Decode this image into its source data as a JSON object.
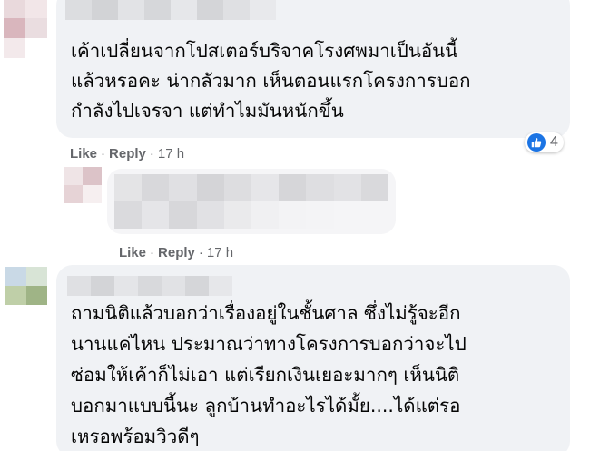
{
  "comments": [
    {
      "text_lines": [
        "เค้าเปลี่ยนจากโปสเตอร์บริจาคโรงศพมาเป็นอันนี้",
        "แล้วหรอคะ น่ากลัวมาก เห็นตอนแรกโครงการบอก",
        "กำลังไปเจรจา แต่ทำไมมันหนักขึ้น"
      ],
      "actions": {
        "like": "Like",
        "reply": "Reply",
        "time": "17 h"
      },
      "reaction": {
        "icon": "like-icon",
        "count": "4",
        "color": "#1b74e4"
      }
    },
    {
      "actions": {
        "like": "Like",
        "reply": "Reply",
        "time": "17 h"
      }
    },
    {
      "text_lines": [
        "ถามนิติแล้วบอกว่าเรื่องอยู่ในชั้นศาล ซึ่งไม่รู้จะอีก",
        "นานแค่ไหน ประมาณว่าทางโครงการบอกว่าจะไป",
        "ซ่อมให้เค้าก็ไม่เอา แต่เรียกเงินเยอะมากๆ เห็นนิติ",
        "บอกมาแบบนี้นะ ลูกบ้านทำอะไรได้มั้ย....ได้แต่รอ",
        "เหรอพร้อมวิวดีๆ"
      ]
    }
  ],
  "separator": "·"
}
